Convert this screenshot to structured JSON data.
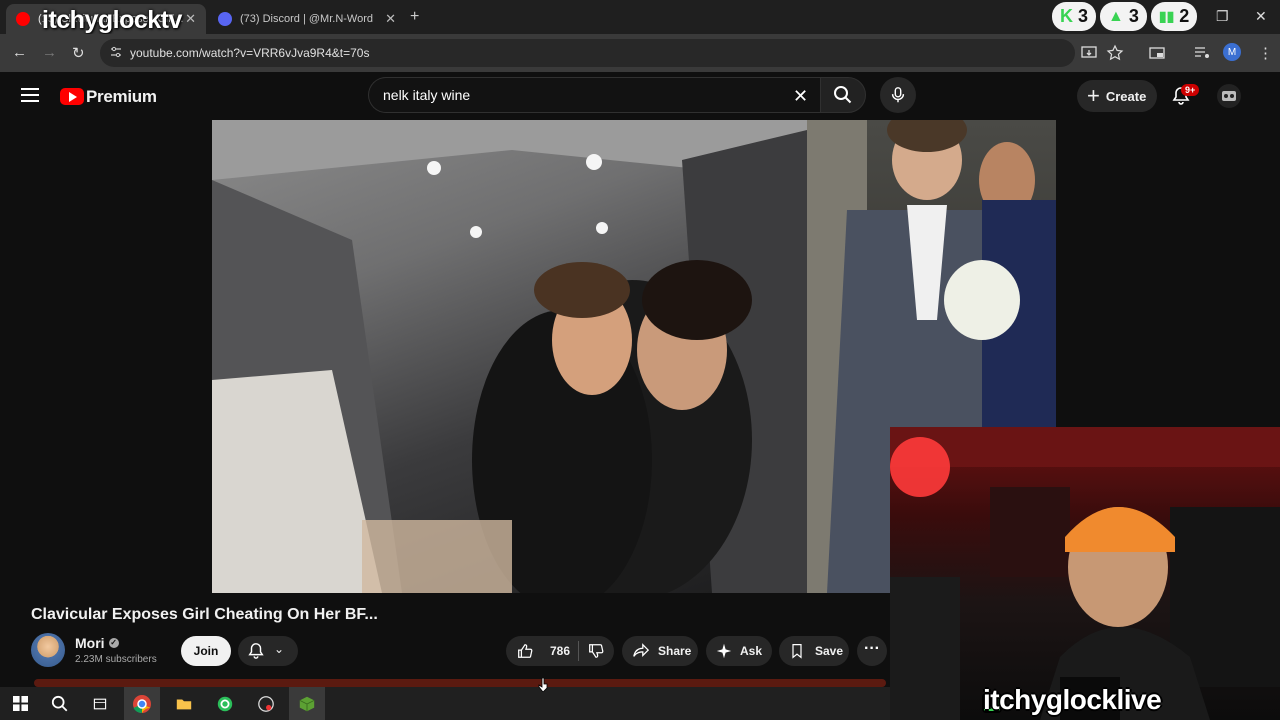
{
  "browser": {
    "tabs": [
      {
        "title": "(15) Clavicular Exposes Girl...",
        "active": true
      },
      {
        "title": "(73) Discord | @Mr.N-Word",
        "active": false
      }
    ],
    "url": "youtube.com/watch?v=VRR6vJva9R4&t=70s",
    "profile_initial": "M"
  },
  "overlay": {
    "watermark_top": "itchyglocktv",
    "watermark_cam": "itchyglocklive",
    "stats": [
      {
        "icon": "kick-icon",
        "value": "3",
        "color": "#39d353"
      },
      {
        "icon": "user-icon",
        "value": "3",
        "color": "#39d353"
      },
      {
        "icon": "bars-icon",
        "value": "2",
        "color": "#39d353"
      }
    ]
  },
  "youtube": {
    "logo_label": "Premium",
    "search_value": "nelk italy wine",
    "create_label": "Create",
    "notification_badge": "9+"
  },
  "video": {
    "title": "Clavicular Exposes Girl Cheating On Her BF...",
    "channel": "Mori",
    "subscribers": "2.23M subscribers",
    "join_label": "Join",
    "likes": "786",
    "share_label": "Share",
    "ask_label": "Ask",
    "save_label": "Save"
  },
  "taskbar": {
    "apps": [
      "windows-start-icon",
      "search-icon",
      "task-view-icon",
      "chrome-icon",
      "file-explorer-icon",
      "app-icon-green",
      "app-icon-obs",
      "app-icon-minecraft"
    ]
  }
}
